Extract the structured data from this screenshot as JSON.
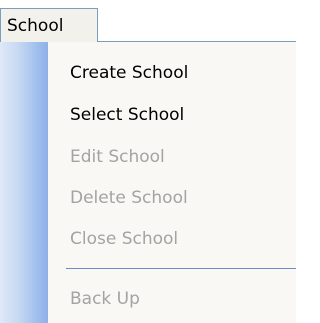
{
  "menubar": {
    "active_menu": "School"
  },
  "menu": {
    "items": [
      {
        "label": "Create School",
        "enabled": true
      },
      {
        "label": "Select School",
        "enabled": true
      },
      {
        "label": "Edit School",
        "enabled": false
      },
      {
        "label": "Delete School",
        "enabled": false
      },
      {
        "label": "Close School",
        "enabled": false
      },
      {
        "label": "Back Up",
        "enabled": false
      }
    ]
  },
  "colors": {
    "menu_border": "#7b9ebd",
    "gutter_gradient_end": "#8fb0e8",
    "disabled_text": "#a3a3a3",
    "separator": "#6d8cc7"
  }
}
